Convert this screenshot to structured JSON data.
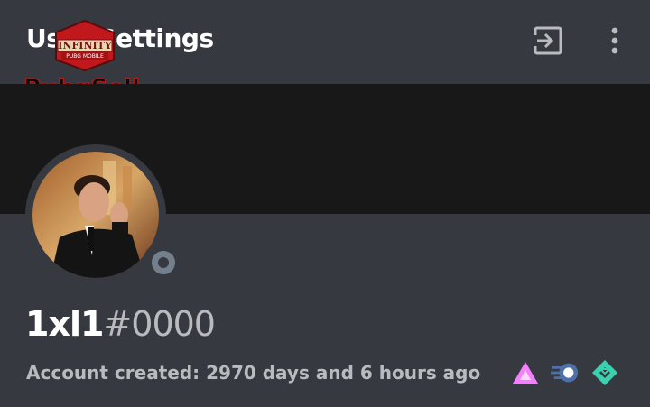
{
  "header": {
    "title": "User Settings",
    "icons": {
      "logout": "logout-icon",
      "more": "more-vertical-icon"
    }
  },
  "watermark": {
    "badge_text": "INFINITY",
    "badge_sub": "PUBG MOBILE",
    "brand_text": "PubgSell"
  },
  "profile": {
    "username": "1xl1",
    "discriminator": "#0000",
    "account_created": "Account created: 2970 days and 6 hours ago",
    "status": "offline",
    "badges": [
      "hypesquad-balance-icon",
      "nitro-boost-icon",
      "hypesquad-icon"
    ]
  },
  "colors": {
    "background": "#36393f",
    "banner": "#181818",
    "status_offline": "#747f8d",
    "badge_pink": "#f47fff",
    "badge_teal": "#3ad0b0"
  }
}
